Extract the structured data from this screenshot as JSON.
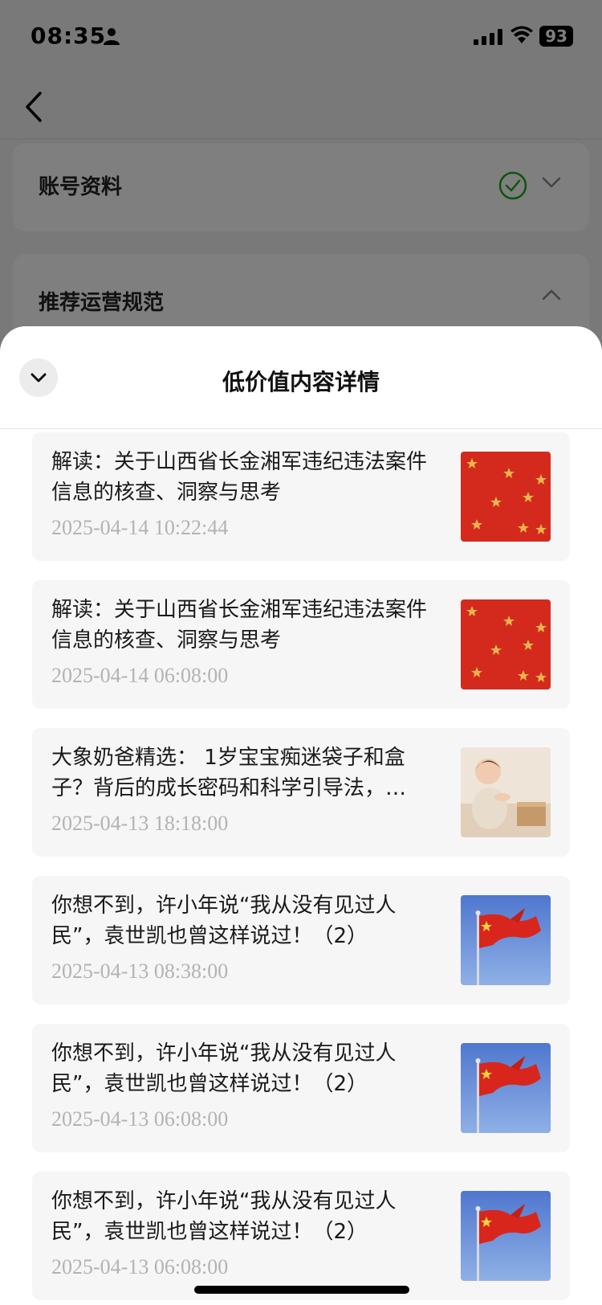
{
  "status_bar": {
    "time": "08:35",
    "battery": "93"
  },
  "background": {
    "card_1": {
      "title": "账号资料"
    },
    "card_2": {
      "title": "推荐运营规范"
    }
  },
  "sheet": {
    "title": "低价值内容详情",
    "items": [
      {
        "title": "解读：关于山西省长金湘军违纪违法案件信息的核查、洞察与思考",
        "time": "2025-04-14 10:22:44",
        "thumbnail": "red-stars-image"
      },
      {
        "title": "解读：关于山西省长金湘军违纪违法案件信息的核查、洞察与思考",
        "time": "2025-04-14 06:08:00",
        "thumbnail": "red-stars-image"
      },
      {
        "title": "大象奶爸精选： 1岁宝宝痴迷袋子和盒子？背后的成长密码和科学引导法，…",
        "time": "2025-04-13 18:18:00",
        "thumbnail": "baby-photo-image"
      },
      {
        "title": "你想不到，许小年说“我从没有见过人民”，袁世凯也曾这样说过！（2）",
        "time": "2025-04-13 08:38:00",
        "thumbnail": "flag-image"
      },
      {
        "title": "你想不到，许小年说“我从没有见过人民”，袁世凯也曾这样说过！（2）",
        "time": "2025-04-13 06:08:00",
        "thumbnail": "flag-image"
      },
      {
        "title": "你想不到，许小年说“我从没有见过人民”，袁世凯也曾这样说过！（2）",
        "time": "2025-04-13 06:08:00",
        "thumbnail": "flag-image"
      }
    ]
  },
  "colors": {
    "check_green": "#1aad19",
    "overlay": "rgba(0,0,0,0.5)",
    "item_bg": "#f6f6f6",
    "time_gray": "#b3b3b3"
  }
}
